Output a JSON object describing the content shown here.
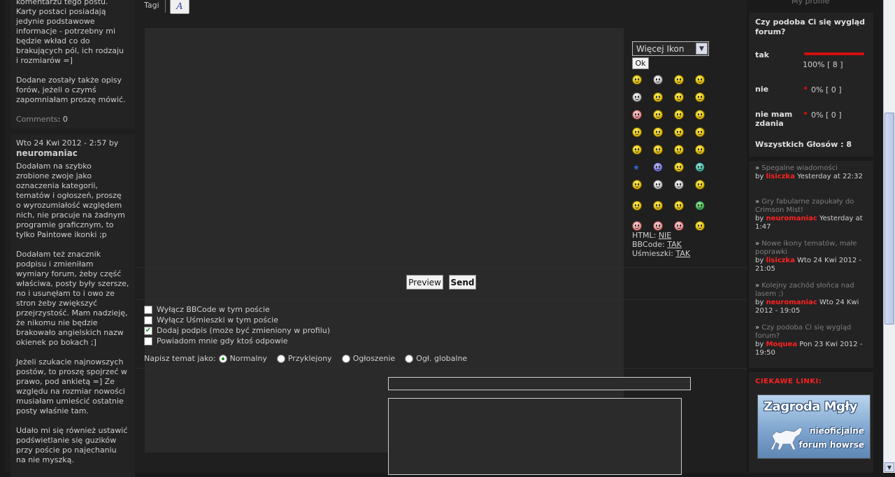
{
  "left": {
    "post1_lines": [
      "komentarzu tego postu.",
      "Karty postaci posiadają",
      "jedynie podstawowe",
      "informacje - potrzebny mi",
      "będzie wkład co do",
      "brakujących pól, ich rodzaju",
      "i rozmiarów =]"
    ],
    "post1_para2": [
      "Dodane zostały także opisy",
      "forów, jeżeli o czymś",
      "zapomniałam proszę mówić."
    ],
    "comments_label": "Comments",
    "comments_count": ": 0",
    "post2_meta": "Wto 24 Kwi 2012 - 2:57 by",
    "post2_author": "neuromaniac",
    "post2_paras": [
      [
        "Dodałam na szybko",
        "zrobione zwoje jako",
        "oznaczenia kategorii,",
        "tematów i ogłoszeń, proszę",
        "o wyrozumiałość względem",
        "nich, nie pracuje na żadnym",
        "programie graficznym, to",
        "tylko Paintowe ikonki ;p"
      ],
      [
        "Dodałam też znacznik",
        "podpisu i zmieniłam",
        "wymiary forum, żeby część",
        "właściwa, posty były szersze,",
        "no i usunęłam to i owo ze",
        "stron żeby zwiększyć",
        "przejrzystość. Mam nadzieję,",
        "że nikomu nie będzie",
        "brakowało angielskich nazw",
        "okienek po bokach ;]"
      ],
      [
        "Jeżeli szukacie najnowszych",
        "postów, to proszę spojrzeć w",
        "prawo, pod ankietą =] Ze",
        "względu na rozmiar nowości",
        "musiałam umieścić ostatnie",
        "posty właśnie tam."
      ],
      [
        "Udało mi się również ustawić",
        "podświetlanie się guzików",
        "przy poście po najechaniu",
        "na nie myszką."
      ]
    ]
  },
  "editor": {
    "tag_label": "Tagi",
    "preview_label": "Preview",
    "send_label": "Send",
    "options": [
      {
        "label": "Wyłącz BBCode w tym poście",
        "checked": false
      },
      {
        "label": "Wyłącz Uśmieszki w tym poście",
        "checked": false
      },
      {
        "label": "Dodaj podpis (może być zmieniony w profilu)",
        "checked": true
      },
      {
        "label": "Powiadom mnie gdy ktoś odpowie",
        "checked": false
      }
    ],
    "topic_as_label": "Napisz temat jako:",
    "topic_types": [
      {
        "label": "Normalny",
        "selected": true
      },
      {
        "label": "Przyklejony",
        "selected": false
      },
      {
        "label": "Ogłoszenie",
        "selected": false
      },
      {
        "label": "Ogł. globalne",
        "selected": false
      }
    ]
  },
  "smilies": {
    "more_icons_label": "Więcej Ikon",
    "ok_label": "Ok",
    "html_label": "HTML:",
    "html_value": "NIE",
    "bbcode_label": "BBCode:",
    "bbcode_value": "TAK",
    "smilies_label": "Uśmieszki:",
    "smilies_value": "TAK"
  },
  "right": {
    "my_profile": "My profile",
    "poll_title": "Czy podoba Ci się wygląd forum?",
    "poll_options": [
      {
        "label": "tak",
        "percent": 100,
        "votes_text": "100% [ 8 ]"
      },
      {
        "label": "nie",
        "percent": 0,
        "votes_text": "0% [ 0 ]"
      },
      {
        "label": "nie mam zdania",
        "percent": 0,
        "votes_text": "0% [ 0 ]"
      }
    ],
    "poll_total": "Wszystkich Głosów : 8",
    "recent": [
      {
        "title": "Spegalne wiadomości",
        "by": "by",
        "user": "lisiczka",
        "date": "Yesterday at 22:32"
      },
      {
        "title": "Gry fabularne zapukały do Crimson Mist!",
        "by": "by",
        "user": "neuromaniac",
        "date": "Yesterday at 1:47"
      },
      {
        "title": "Nowe ikony tematów, małe poprawki",
        "by": "by",
        "user": "lisiczka",
        "date": "Wto 24 Kwi 2012 - 21:05"
      },
      {
        "title": "Kolejny zachód słońca nad lasem ;)",
        "by": "by",
        "user": "neuromaniac",
        "date": "Wto 24 Kwi 2012 - 19:05"
      },
      {
        "title": "Czy podoba Ci się wygląd forum?",
        "by": "by",
        "user": "Moquea",
        "date": "Pon 23 Kwi 2012 - 19:50"
      }
    ],
    "links_title": "CIEKAWE LINKI:",
    "banner_title": "Zagroda Mgły",
    "banner_line1": "nieoficjalne",
    "banner_line2": "forum howrse"
  },
  "colors": {
    "accent_red": "#ff2020",
    "poll_bar": "#d01010",
    "background": "#1a1a1a"
  }
}
